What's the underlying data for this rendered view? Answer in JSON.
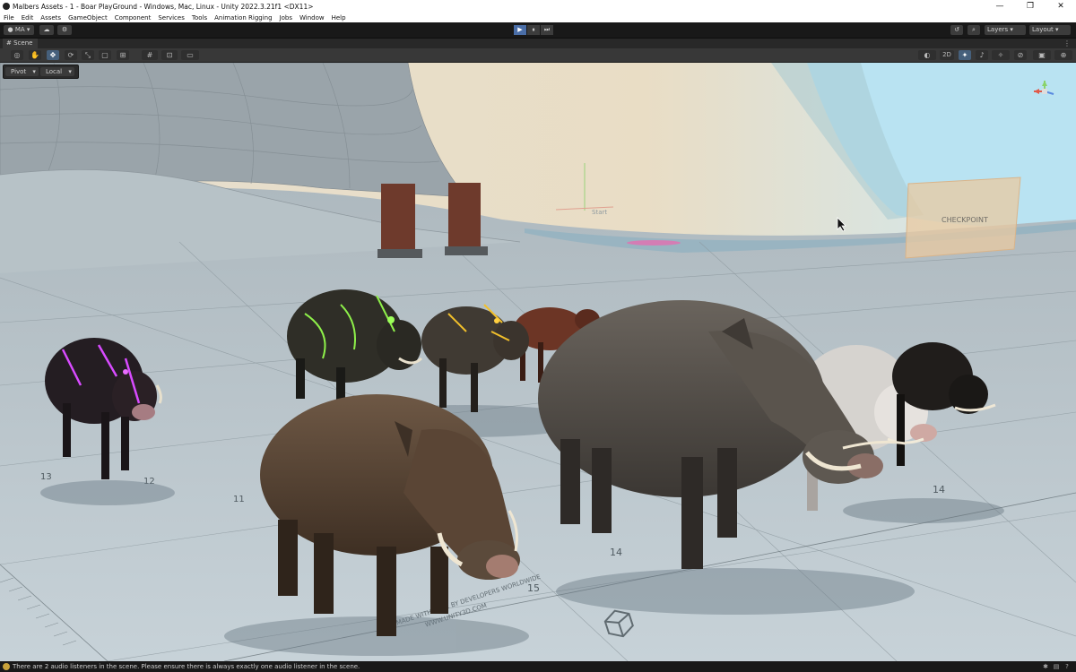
{
  "window": {
    "title": "Malbers Assets - 1 - Boar PlayGround - Windows, Mac, Linux - Unity 2022.3.21f1 <DX11>",
    "minimize": "—",
    "maximize": "❐",
    "close": "✕"
  },
  "menu": [
    "File",
    "Edit",
    "Assets",
    "GameObject",
    "Component",
    "Services",
    "Tools",
    "Animation Rigging",
    "Jobs",
    "Window",
    "Help"
  ],
  "toolbar": {
    "account": "MA",
    "play": "▶",
    "pause": "⏸",
    "step": "⏭",
    "layers": "Layers",
    "layout": "Layout"
  },
  "scene_tab": {
    "label": "Scene"
  },
  "scene_toolbar": {
    "mode_2d": "2D"
  },
  "overlay": {
    "pivot": "Pivot",
    "local": "Local"
  },
  "scene": {
    "floor_text": "MADE WITH LOVE BY DEVELOPERS WORLDWIDE",
    "floor_url": "WWW.UNITY3D.COM",
    "checkpoint_label": "CHECKPOINT",
    "start_label": "Start",
    "ruler_numbers": [
      "15",
      "14",
      "14",
      "13",
      "12",
      "11"
    ]
  },
  "status": {
    "message": "There are 2 audio listeners in the scene. Please ensure there is always exactly one audio listener in the scene."
  },
  "colors": {
    "accent": "#4a6ea8",
    "sky": "#b9e3f2",
    "floor": "#bac7cf"
  }
}
